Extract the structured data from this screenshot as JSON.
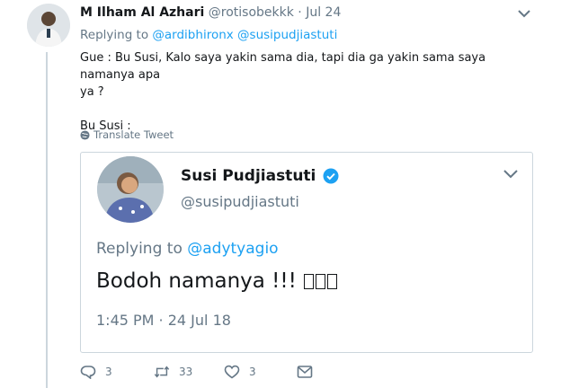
{
  "tweet": {
    "author_name": "M Ilham Al Azhari",
    "author_handle": "@rotisobekkk",
    "separator": "·",
    "date": "Jul 24",
    "replying_prefix": "Replying to",
    "replying_mentions": [
      "@ardibhironx",
      "@susipudjiastuti"
    ],
    "text_lines": [
      "Gue : Bu Susi, Kalo saya yakin sama dia, tapi dia ga yakin sama saya namanya apa",
      "ya ?",
      "",
      "Bu Susi :"
    ],
    "translate_label": "Translate Tweet"
  },
  "quoted": {
    "author_name": "Susi Pudjiastuti",
    "author_handle": "@susipudjiastuti",
    "replying_prefix": "Replying to",
    "replying_mention": "@adytyagio",
    "text": "Bodoh namanya !!!",
    "time": "1:45 PM · 24 Jul 18"
  },
  "actions": {
    "reply_count": "3",
    "retweet_count": "33",
    "like_count": "3"
  },
  "icons": [
    "caret-down-icon",
    "globe-icon",
    "verified-badge-icon",
    "reply-icon",
    "retweet-icon",
    "like-icon",
    "direct-message-icon"
  ],
  "colors": {
    "link": "#1da1f2",
    "secondary_text": "#657786",
    "border": "#ccd6dd",
    "verified": "#1da1f2"
  }
}
